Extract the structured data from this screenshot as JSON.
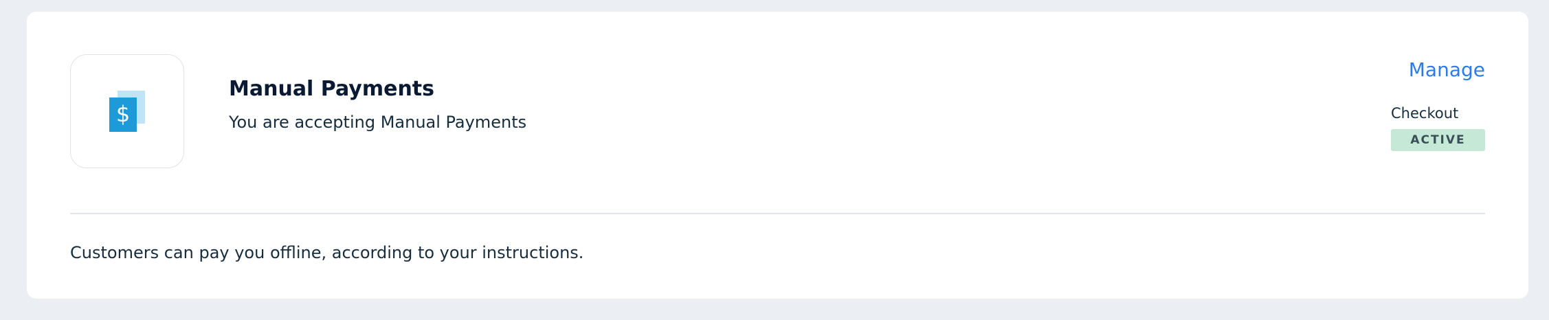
{
  "payment_method": {
    "title": "Manual Payments",
    "subtitle": "You are accepting Manual Payments",
    "icon": "dollar-document-icon",
    "manage_label": "Manage",
    "checkout_label": "Checkout",
    "status": "ACTIVE",
    "description": "Customers can pay you offline, according to your instructions."
  },
  "colors": {
    "background": "#ebeef3",
    "card": "#ffffff",
    "accent_link": "#2b7bef",
    "icon_primary": "#1d9bd8",
    "icon_secondary": "#bfe3f7",
    "status_badge_bg": "#c6e8d6",
    "status_badge_text": "#3a4e57"
  }
}
